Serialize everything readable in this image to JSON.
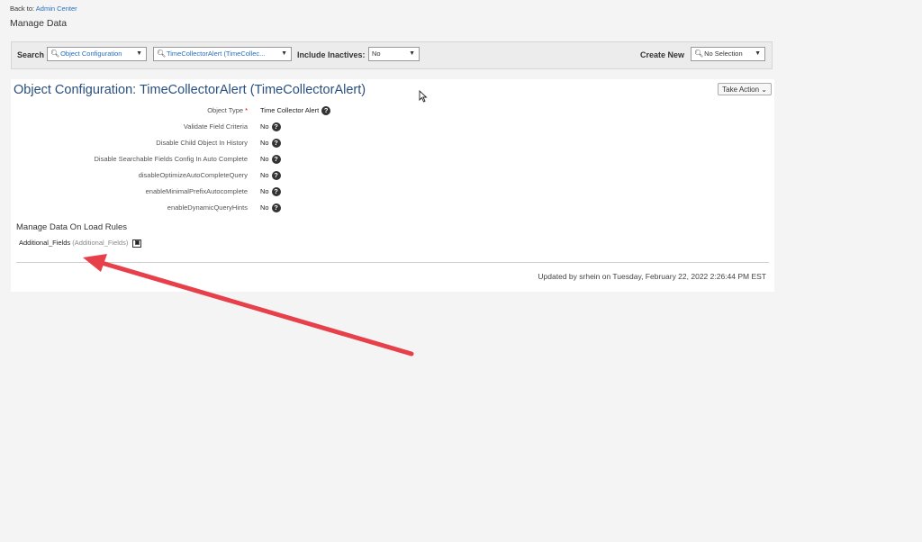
{
  "nav": {
    "back_prefix": "Back to:",
    "back_link": "Admin Center",
    "page_title": "Manage Data"
  },
  "searchbar": {
    "search_label": "Search",
    "type_select": "Object Configuration",
    "object_select": "TimeCollectorAlert (TimeCollec...",
    "include_inactives_label": "Include Inactives:",
    "include_inactives_value": "No",
    "create_new_label": "Create New",
    "create_new_value": "No Selection"
  },
  "panel": {
    "title": "Object Configuration: TimeCollectorAlert (TimeCollectorAlert)",
    "take_action": "Take Action",
    "fields": [
      {
        "label": "Object Type",
        "value": "Time Collector Alert",
        "required": "*"
      },
      {
        "label": "Validate Field Criteria",
        "value": "No"
      },
      {
        "label": "Disable Child Object In History",
        "value": "No"
      },
      {
        "label": "Disable Searchable Fields Config In Auto Complete",
        "value": "No"
      },
      {
        "label": "disableOptimizeAutoCompleteQuery",
        "value": "No"
      },
      {
        "label": "enableMinimalPrefixAutocomplete",
        "value": "No"
      },
      {
        "label": "enableDynamicQueryHints",
        "value": "No"
      }
    ],
    "rules_title": "Manage Data On Load Rules",
    "rule_name": "Additional_Fields",
    "rule_code": "(Additional_Fields)",
    "updated": "Updated by srhein on Tuesday, February 22, 2022 2:26:44 PM EST"
  },
  "icons": {
    "help": "?",
    "search": "magnifier-icon",
    "dropdown": "caret-down-icon",
    "annotation_color": "#e8404a"
  }
}
